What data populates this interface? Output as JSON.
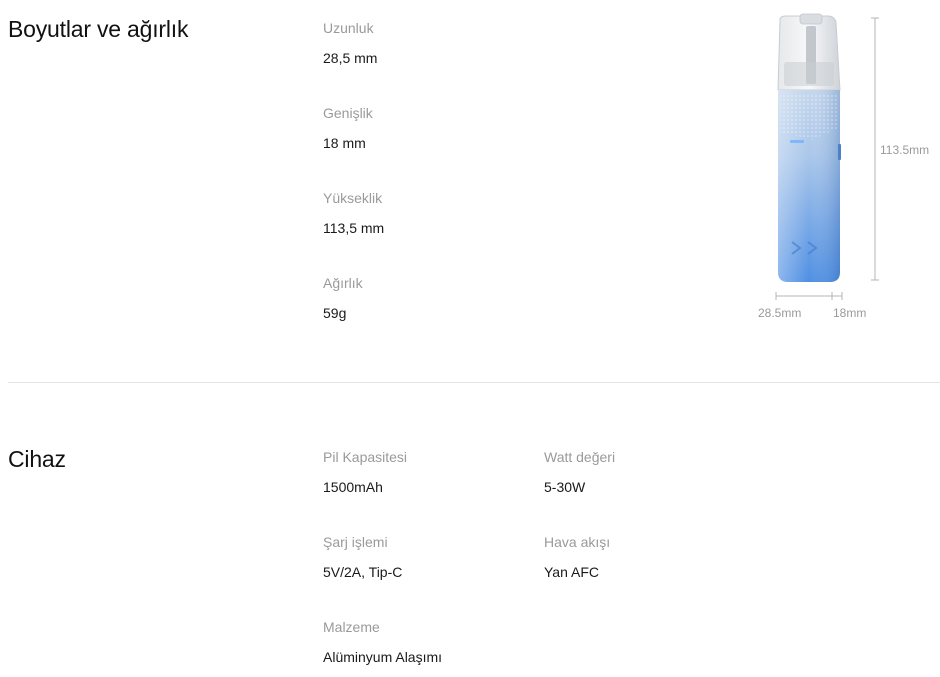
{
  "sections": {
    "dimensions": {
      "title": "Boyutlar ve ağırlık",
      "specs": [
        {
          "label": "Uzunluk",
          "value": "28,5 mm"
        },
        {
          "label": "Genişlik",
          "value": "18 mm"
        },
        {
          "label": "Yükseklik",
          "value": "113,5 mm"
        },
        {
          "label": "Ağırlık",
          "value": "59g"
        }
      ],
      "figure": {
        "height_label": "113.5mm",
        "length_label": "28.5mm",
        "width_label": "18mm"
      }
    },
    "device": {
      "title": "Cihaz",
      "specs": [
        {
          "label": "Pil Kapasitesi",
          "value": "1500mAh"
        },
        {
          "label": "Watt değeri",
          "value": "5-30W"
        },
        {
          "label": "Şarj işlemi",
          "value": "5V/2A, Tip-C"
        },
        {
          "label": "Hava akışı",
          "value": "Yan AFC"
        },
        {
          "label": "Malzeme",
          "value": "Alüminyum Alaşımı"
        }
      ]
    }
  },
  "colors": {
    "device_top": "#b9d2ee",
    "device_bottom": "#4f8fe3",
    "label": "#9a9a9a",
    "divider": "#e3e3e3"
  }
}
